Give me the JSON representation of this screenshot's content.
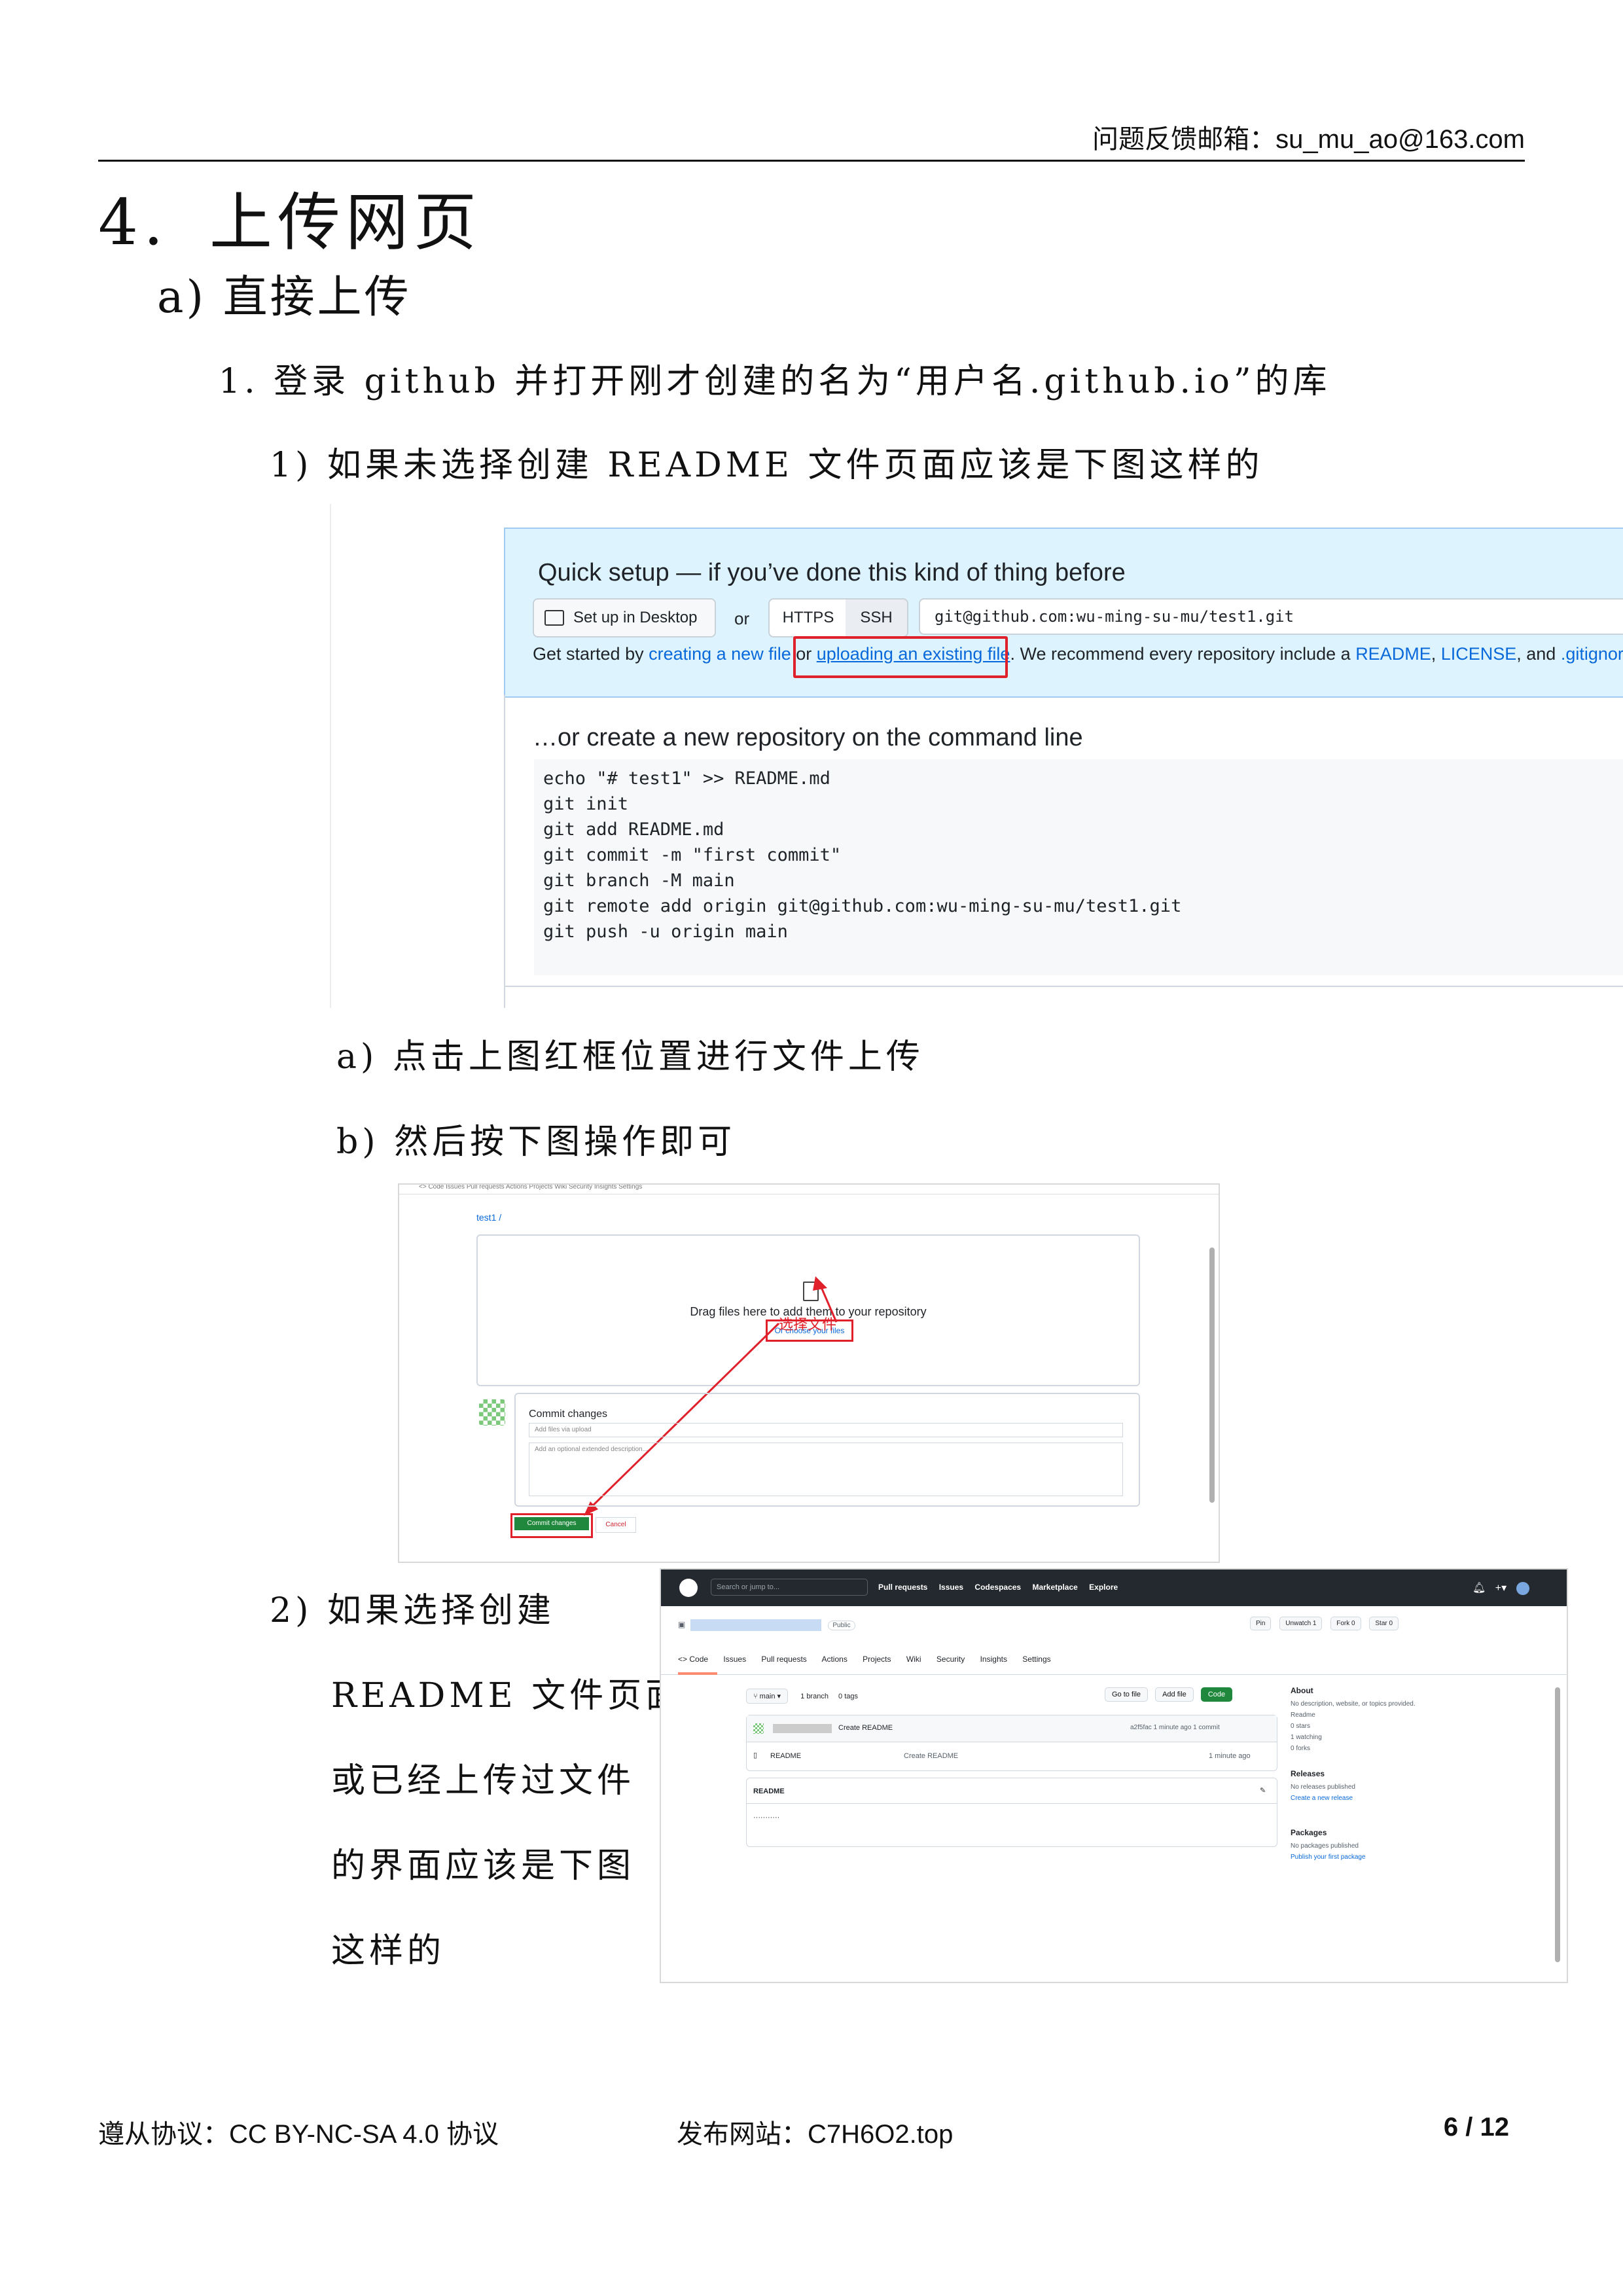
{
  "header": {
    "email": "问题反馈邮箱：su_mu_ao@163.com"
  },
  "section": {
    "number": "4.",
    "title": "上传网页"
  },
  "subsection": "a) 直接上传",
  "steps": {
    "s1": "1.  登录 github 并打开刚才创建的名为“用户名.github.io”的库",
    "s1a": "1)  如果未选择创建 README 文件页面应该是下图这样的",
    "a": "a)  点击上图红框位置进行文件上传",
    "b": "b)  然后按下图操作即可",
    "s2_lines": [
      "2)  如果选择创建",
      "README 文件页面，",
      "或已经上传过文件",
      "的界面应该是下图",
      "这样的"
    ]
  },
  "ss1": {
    "quick_title": "Quick setup — if you’ve done this kind of thing before",
    "desktop_btn": "Set up in Desktop",
    "or": "or",
    "https": "HTTPS",
    "ssh": "SSH",
    "url": "git@github.com:wu-ming-su-mu/test1.git",
    "gs_prefix": "Get started by ",
    "gs_link1": "creating a new file",
    "gs_or": " or ",
    "gs_link2": "uploading an existing file",
    "gs_mid": ". We recommend every repository include a ",
    "gs_readme": "README",
    "gs_comma": ", ",
    "gs_license": "LICENSE",
    "gs_and": ", and ",
    "gs_gitignore": ".gitignore",
    "gs_end": ".",
    "cmd_title": "…or create a new repository on the command line",
    "code": [
      "echo \"# test1\" >> README.md",
      "git init",
      "git add README.md",
      "git commit -m \"first commit\"",
      "git branch -M main",
      "git remote add origin git@github.com:wu-ming-su-mu/test1.git",
      "git push -u origin main"
    ]
  },
  "ss2": {
    "tabs": "<> Code   Issues   Pull requests   Actions   Projects   Wiki   Security   Insights   Settings",
    "crumb": "test1 /",
    "drag_text": "Drag files here to add them to your repository",
    "choose": "Or choose your files",
    "annotation": "选择文件",
    "commit_title": "Commit changes",
    "input1": "Add files via upload",
    "input2": "Add an optional extended description...",
    "commit_btn": "Commit changes",
    "cancel": "Cancel"
  },
  "ss3": {
    "search": "Search or jump to...",
    "nav": [
      "Pull requests",
      "Issues",
      "Codespaces",
      "Marketplace",
      "Explore"
    ],
    "public": "Public",
    "actions": [
      "Pin",
      "Unwatch 1",
      "Fork 0",
      "Star 0"
    ],
    "tabs": [
      "<> Code",
      "Issues",
      "Pull requests",
      "Actions",
      "Projects",
      "Wiki",
      "Security",
      "Insights",
      "Settings"
    ],
    "branch": "main",
    "branches": "1 branch",
    "tags": "0 tags",
    "goto": "Go to file",
    "addfile": "Add file",
    "code_btn": "Code",
    "commit_msg": "Create README",
    "commit_meta": "a2f5fac  1 minute ago   1 commit",
    "file_name": "README",
    "file_msg": "Create README",
    "file_time": "1 minute ago",
    "readme_title": "README",
    "readme_body": "···········",
    "about": "About",
    "about_desc": "No description, website, or topics provided.",
    "about_items": [
      "Readme",
      "0 stars",
      "1 watching",
      "0 forks"
    ],
    "releases": "Releases",
    "releases_m": "No releases published",
    "releases_l": "Create a new release",
    "packages": "Packages",
    "packages_m": "No packages published",
    "packages_l": "Publish your first package"
  },
  "footer": {
    "license": "遵从协议：CC BY-NC-SA 4.0 协议",
    "site": "发布网站：C7H6O2.top",
    "page": "6 / 12"
  }
}
